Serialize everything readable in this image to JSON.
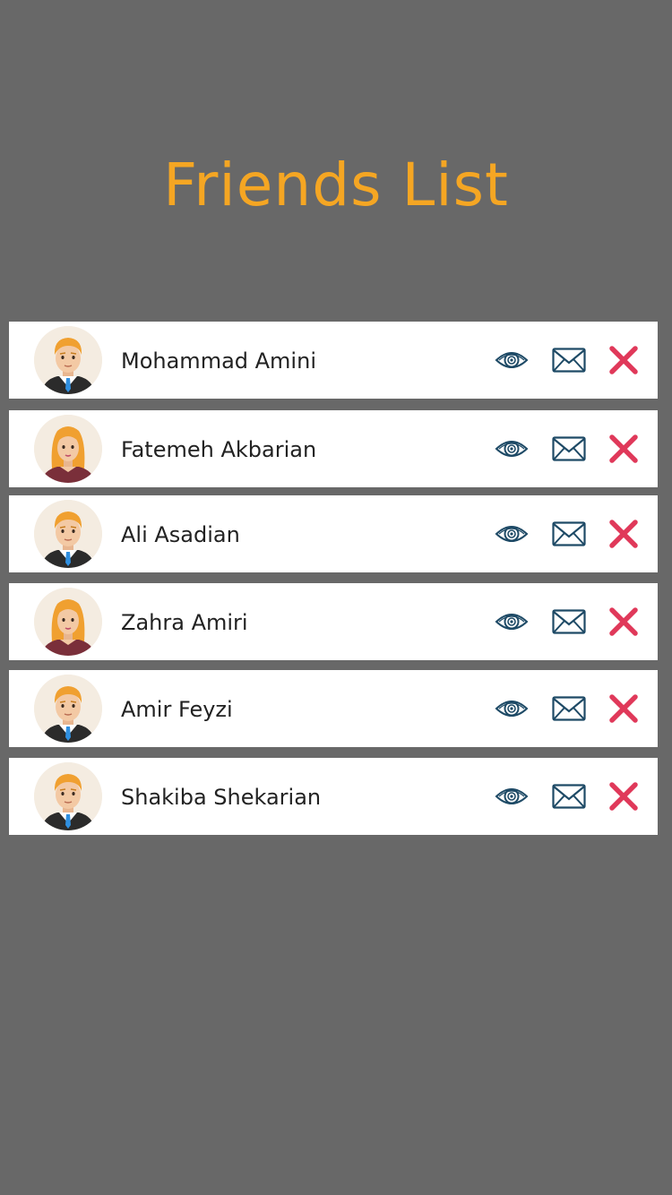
{
  "header": {
    "title": "Friends List"
  },
  "colors": {
    "background": "#686868",
    "title": "#f5a623",
    "row": "#ffffff",
    "icon": "#1e4a66",
    "delete": "#e0395a"
  },
  "icons": {
    "view": "eye-icon",
    "message": "envelope-icon",
    "delete": "close-icon"
  },
  "friends": [
    {
      "name": "Mohammad Amini",
      "avatar": "male"
    },
    {
      "name": "Fatemeh Akbarian",
      "avatar": "female"
    },
    {
      "name": "Ali Asadian",
      "avatar": "male"
    },
    {
      "name": "Zahra Amiri",
      "avatar": "female"
    },
    {
      "name": "Amir Feyzi",
      "avatar": "male"
    },
    {
      "name": "Shakiba Shekarian",
      "avatar": "male"
    }
  ]
}
